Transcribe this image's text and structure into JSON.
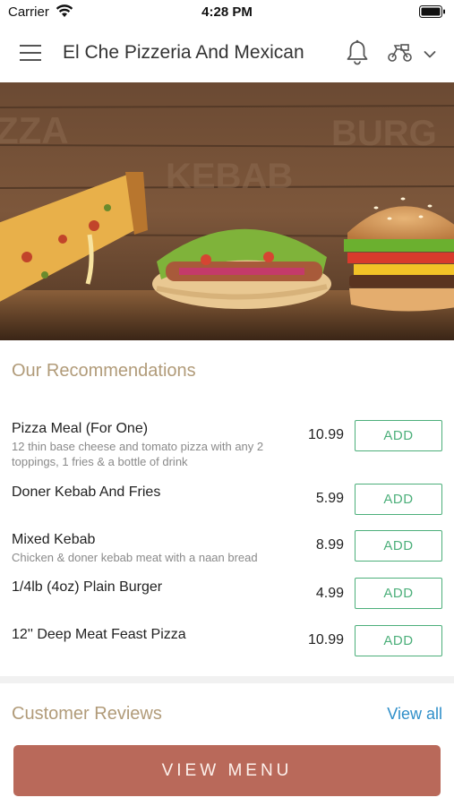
{
  "status_bar": {
    "carrier": "Carrier",
    "time": "4:28 PM"
  },
  "header": {
    "title": "El Che Pizzeria And Mexican",
    "icons": [
      "menu-icon",
      "bell-icon",
      "delivery-icon",
      "chevron-down-icon"
    ]
  },
  "hero": {
    "signage": [
      "ZZA",
      "KEBAB",
      "BURG"
    ]
  },
  "recommendations": {
    "title": "Our Recommendations",
    "add_label": "ADD",
    "items": [
      {
        "name": "Pizza Meal (For One)",
        "description": "12 thin base cheese and tomato pizza with any 2 toppings, 1 fries & a bottle of drink",
        "price": "10.99"
      },
      {
        "name": "Doner Kebab And Fries",
        "description": "",
        "price": "5.99"
      },
      {
        "name": "Mixed Kebab",
        "description": "Chicken & doner kebab meat with a naan bread",
        "price": "8.99"
      },
      {
        "name": "1/4lb (4oz) Plain Burger",
        "description": "",
        "price": "4.99"
      },
      {
        "name": "12'' Deep Meat Feast Pizza",
        "description": "",
        "price": "10.99"
      }
    ]
  },
  "reviews": {
    "title": "Customer Reviews",
    "view_all": "View all"
  },
  "footer": {
    "view_menu": "VIEW MENU"
  },
  "colors": {
    "accent_green": "#4caf7a",
    "section_title": "#b19b79",
    "link_blue": "#2f8fc9",
    "button_brown": "#b9695a"
  }
}
